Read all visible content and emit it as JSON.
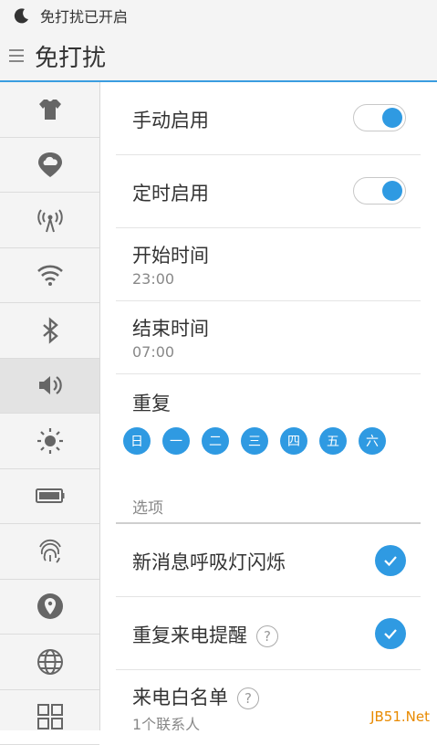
{
  "status_bar": {
    "text": "免打扰已开启",
    "icon": "moon-icon"
  },
  "title_bar": {
    "title": "免打扰",
    "menu_icon": "menu-icon"
  },
  "sidebar": {
    "items": [
      {
        "icon": "theme-shirt-icon"
      },
      {
        "icon": "cloud-location-icon"
      },
      {
        "icon": "hotspot-icon"
      },
      {
        "icon": "wifi-icon"
      },
      {
        "icon": "bluetooth-icon"
      },
      {
        "icon": "sound-icon",
        "active": true
      },
      {
        "icon": "brightness-icon"
      },
      {
        "icon": "battery-icon"
      },
      {
        "icon": "fingerprint-icon"
      },
      {
        "icon": "location-icon"
      },
      {
        "icon": "globe-icon"
      },
      {
        "icon": "apps-grid-icon"
      }
    ]
  },
  "settings": {
    "manual": {
      "label": "手动启用",
      "enabled": true
    },
    "scheduled": {
      "label": "定时启用",
      "enabled": true
    },
    "start_time": {
      "label": "开始时间",
      "value": "23:00"
    },
    "end_time": {
      "label": "结束时间",
      "value": "07:00"
    },
    "repeat": {
      "label": "重复",
      "days": [
        "日",
        "一",
        "二",
        "三",
        "四",
        "五",
        "六"
      ]
    }
  },
  "options": {
    "section_title": "选项",
    "breathing_light": {
      "label": "新消息呼吸灯闪烁",
      "checked": true
    },
    "repeat_call": {
      "label": "重复来电提醒",
      "checked": true,
      "help": "?"
    },
    "whitelist": {
      "label": "来电白名单",
      "value": "1个联系人",
      "help": "?"
    }
  },
  "watermark": "JB51.Net",
  "colors": {
    "accent": "#2f9ae2",
    "sidebar_bg": "#f4f4f4",
    "divider": "#e4e4e4"
  }
}
